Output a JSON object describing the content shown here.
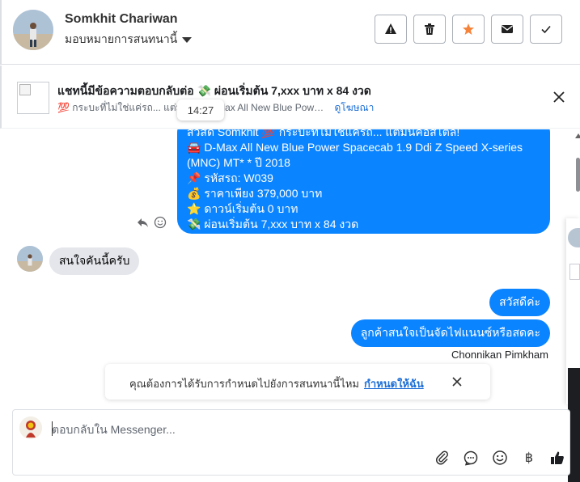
{
  "header": {
    "contact_name": "Somkhit Chariwan",
    "assign_label": "มอบหมายการสนทนานี้",
    "buttons": [
      {
        "name": "report",
        "icon": "warning-icon"
      },
      {
        "name": "delete",
        "icon": "trash-icon"
      },
      {
        "name": "star",
        "icon": "star-icon"
      },
      {
        "name": "mark-unread",
        "icon": "envelope-icon"
      },
      {
        "name": "mark-done",
        "icon": "check-icon"
      }
    ]
  },
  "ad": {
    "title": "แชทนี้มีข้อความตอบกลับต่อ 💸 ผ่อนเริ่มต้น 7,xxx บาท x 84 งวด",
    "subtitle": "💯 กระบะที่ไม่ใช่แค่รถ... แต่มัน 🚘 D-Max All New Blue Pow…",
    "link": "ดูโฆษณา"
  },
  "tooltip_time": "14:27",
  "messages": {
    "outgoing_ad_lines": [
      "สวัสดี Somkhit 💯 กระบะที่ไม่ใช่แค่รถ... แต่มันคือสไตล์!",
      "🚘 D-Max All New Blue Power Spacecab 1.9 Ddi Z Speed X-series",
      "(MNC) MT* * ปี 2018",
      "📌 รหัสรถ: W039",
      "💰 ราคาเพียง 379,000 บาท",
      "⭐ ดาวน์เริ่มต้น 0 บาท",
      "💸 ผ่อนเริ่มต้น 7,xxx บาท x 84 งวด"
    ],
    "incoming_1": "สนใจคันนี้ครับ",
    "outgoing_2": "สวัสดีค่ะ",
    "outgoing_3": "ลูกค้าสนใจเป็นจัดไฟแนนซ์หรือสดคะ",
    "sender_name": "Chonnikan Pimkham"
  },
  "assign_prompt": {
    "text": "คุณต้องการได้รับการกำหนดไปยังการสนทนานี้ไหม",
    "link": "กำหนดให้ฉัน"
  },
  "composer": {
    "placeholder": "ตอบกลับใน Messenger...",
    "tools": [
      "paperclip-icon",
      "saved-replies-icon",
      "emoji-icon",
      "baht-icon",
      "thumbs-up-icon"
    ],
    "baht_glyph": "฿"
  },
  "colors": {
    "bubble_outgoing": "#0b84ff",
    "bubble_incoming": "#e4e6eb",
    "link": "#1d6fd6",
    "star": "#f5833a"
  }
}
